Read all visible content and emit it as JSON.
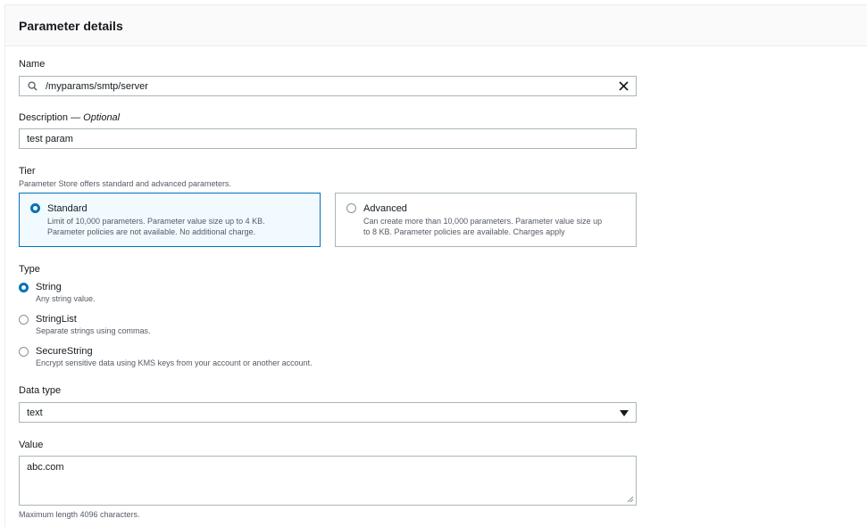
{
  "panel": {
    "title": "Parameter details"
  },
  "name": {
    "label": "Name",
    "value": "/myparams/smtp/server"
  },
  "description": {
    "label": "Description",
    "optional": "— Optional",
    "value": "test param"
  },
  "tier": {
    "label": "Tier",
    "hint": "Parameter Store offers standard and advanced parameters.",
    "options": [
      {
        "label": "Standard",
        "desc_line1": "Limit of 10,000 parameters. Parameter value size up to 4 KB.",
        "desc_line2": "Parameter policies are not available. No additional charge.",
        "selected": true
      },
      {
        "label": "Advanced",
        "desc_line1": "Can create more than 10,000 parameters. Parameter value size up",
        "desc_line2": "to 8 KB. Parameter policies are available. Charges apply",
        "selected": false
      }
    ]
  },
  "type": {
    "label": "Type",
    "options": [
      {
        "label": "String",
        "desc": "Any string value.",
        "selected": true
      },
      {
        "label": "StringList",
        "desc": "Separate strings using commas.",
        "selected": false
      },
      {
        "label": "SecureString",
        "desc": "Encrypt sensitive data using KMS keys from your account or another account.",
        "selected": false
      }
    ]
  },
  "data_type": {
    "label": "Data type",
    "value": "text"
  },
  "value": {
    "label": "Value",
    "value": "abc.com",
    "hint": "Maximum length 4096 characters."
  },
  "colors": {
    "accent": "#0073bb",
    "border": "#aab7b8",
    "selected_bg": "#f1faff"
  },
  "icons": {
    "search": "search-icon",
    "clear": "close-icon",
    "dropdown": "caret-down-icon"
  }
}
